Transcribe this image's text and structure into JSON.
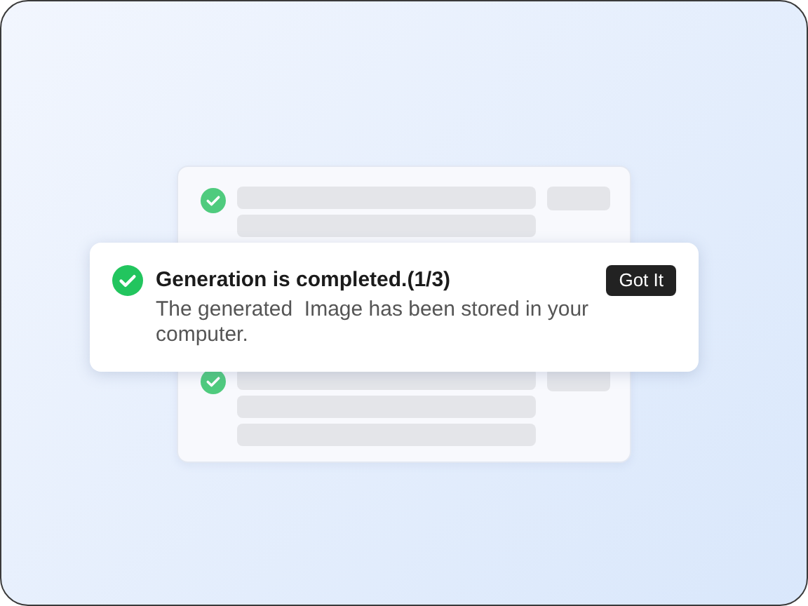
{
  "toast": {
    "title": "Generation is completed.(1/3)",
    "message": "The generated  Image has been stored in your computer.",
    "button": "Got It"
  }
}
